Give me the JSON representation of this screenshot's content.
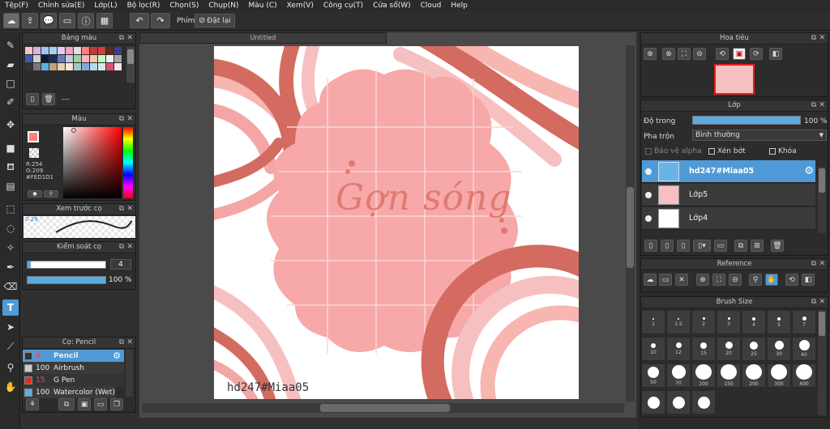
{
  "menu": [
    "Tệp(F)",
    "Chỉnh sửa(E)",
    "Lớp(L)",
    "Bộ lọc(R)",
    "Chọn(S)",
    "Chụp(N)",
    "Màu (C)",
    "Xem(V)",
    "Công cụ(T)",
    "Cửa sổ(W)",
    "Cloud",
    "Help"
  ],
  "toolbar": {
    "keys_label": "Phím",
    "reset_label": "Đặt lại"
  },
  "palette": {
    "title": "Bảng màu",
    "swatches": [
      "#f4c6d0",
      "#d8b4e0",
      "#a2c8f0",
      "#9ed7f5",
      "#e9c9f2",
      "#f0a6c1",
      "#e0e0e0",
      "#ff8080",
      "#c23b3b",
      "#cc4141",
      "#5c2a1f",
      "#3d3d8f",
      "#3b5aa8",
      "#d0d0d0",
      "#0b1c3a",
      "#1c2e55",
      "#6a79c0",
      "#c7c7e8",
      "#a0d0a0",
      "#ffb3c6",
      "#f7c7a8",
      "#c0ffc0",
      "#f0f0f0",
      "#a3a3a3",
      "#333333",
      "#777777",
      "#5ab0e0",
      "#c8a080",
      "#e8d0b0",
      "#f8e8d0",
      "#9ec9c9",
      "#88a8d8",
      "#b8d8f0",
      "#d8e8f0",
      "#e05070",
      "#fce4ec"
    ],
    "label": "---"
  },
  "color_panel": {
    "title": "Màu",
    "r": "R:254",
    "g": "G:209",
    "hex": "#FED1D1"
  },
  "preview": {
    "title": "Xem trước cọ",
    "size": "0.29"
  },
  "brush_ctrl": {
    "title": "Kiểm soát cọ",
    "size": "4",
    "opacity": "100 %"
  },
  "brush_list": {
    "title": "Cọ: Pencil",
    "items": [
      {
        "size": "4",
        "name": "Pencil",
        "color": "#333333"
      },
      {
        "size": "100",
        "name": "Airbrush",
        "color": "#cccccc"
      },
      {
        "size": "15",
        "name": "G Pen",
        "color": "#d83030"
      },
      {
        "size": "100",
        "name": "Watercolor (Wet)",
        "color": "#5ab0e0"
      }
    ]
  },
  "canvas": {
    "tab": "Untitled",
    "artwork_text": "Gợn sóng",
    "watermark": "hd247#Miaa05"
  },
  "navigator": {
    "title": "Hoa tiêu"
  },
  "layers": {
    "title": "Lớp",
    "opacity_label": "Độ trong",
    "opacity_value": "100 %",
    "opacity_fraction": 1.0,
    "blend_label": "Pha trộn",
    "blend_value": "Bình thường",
    "protect_alpha": "Bảo vệ alpha",
    "clipping": "Xén bớt",
    "lock": "Khóa",
    "items": [
      {
        "name": "hd247#Miaa05",
        "selected": true
      },
      {
        "name": "Lớp5",
        "selected": false
      },
      {
        "name": "Lớp4",
        "selected": false
      }
    ]
  },
  "reference": {
    "title": "Reference"
  },
  "brush_size": {
    "title": "Brush Size",
    "sizes": [
      "1",
      "1.5",
      "2",
      "3",
      "4",
      "5",
      "7",
      "10",
      "12",
      "15",
      "20",
      "25",
      "30",
      "40",
      "50",
      "70",
      "100",
      "150",
      "200",
      "300",
      "400",
      "",
      "",
      ""
    ]
  },
  "colors": {
    "accent": "#5aaae0",
    "selected_row": "#4f9ad6",
    "art_pink": "#f7a8a8",
    "art_dark": "#d36b60"
  }
}
